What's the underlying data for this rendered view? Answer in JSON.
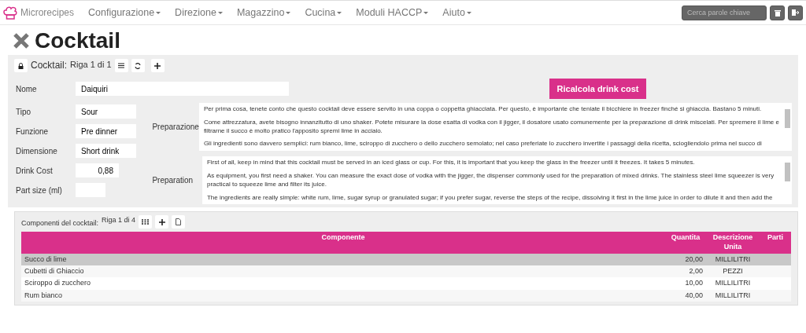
{
  "navbar": {
    "brand": "Microrecipes",
    "menus": [
      {
        "label": "Configurazione"
      },
      {
        "label": "Direzione"
      },
      {
        "label": "Magazzino"
      },
      {
        "label": "Cucina"
      },
      {
        "label": "Moduli HACCP"
      },
      {
        "label": "Aiuto"
      }
    ],
    "search": {
      "placeholder": "Cerca parole chiave"
    }
  },
  "page_title": "Cocktail",
  "record_bar": {
    "label": "Cocktail:",
    "counter": "Riga 1 di 1"
  },
  "name_field": {
    "label": "Nome",
    "value": "Daiquiri"
  },
  "recalc_button": "Ricalcola drink cost",
  "fields": [
    {
      "label": "Tipo",
      "value": "Sour",
      "kind": "text"
    },
    {
      "label": "Funzione",
      "value": "Pre dinner",
      "kind": "text"
    },
    {
      "label": "Dimensione",
      "value": "Short drink",
      "kind": "text"
    },
    {
      "label": "Drink Cost",
      "value": "0,88",
      "kind": "number"
    },
    {
      "label": "Part size (ml)",
      "kind": "number"
    }
  ],
  "texts": [
    {
      "label": "Preparazione",
      "paragraphs": [
        "Per prima cosa, tenete conto che questo cocktail deve essere servito in una coppa o coppetta ghiacciata. Per questo, è importante che teniate il bicchiere in freezer finché si ghiaccia. Bastano 5 minuti.",
        "Come attrezzatura, avete bisogno innanzitutto di uno shaker. Potete misurare la dose esatta di vodka con il jigger, il dosatore usato comunemente per la preparazione di drink miscelati. Per spremere il lime e filtrarne il succo è molto pratico l'apposito spremi lime in acciaio.",
        "Gli ingredienti sono davvero semplici: rum bianco, lime, sciroppo di zucchero o dello zucchero semolato; nel caso preferiate lo zucchero invertite i passaggi della ricetta, sciogliendolo prima nel succo di"
      ]
    },
    {
      "label": "Preparation",
      "paragraphs": [
        "First of all, keep in mind that this cocktail must be served in an iced glass or cup. For this, it is important that you keep the glass in the freezer until it freezes. It takes 5 minutes.",
        "As equipment, you first need a shaker. You can measure the exact dose of vodka with the jigger, the dispenser commonly used for the preparation of mixed drinks. The stainless steel lime squeezer is very practical to squeeze lime and filter its juice.",
        "The ingredients are really simple: white rum, lime, sugar syrup or granulated sugar; if you prefer sugar, reverse the steps of the recipe, dissolving it first in the lime juice in order to dilute it and then add the"
      ]
    }
  ],
  "components": {
    "label": "Componenti del cocktail:",
    "counter": "Riga 1 di 4",
    "columns": [
      "Componente",
      "Quantita",
      "Descrizione Unita",
      "Parti"
    ],
    "rows": [
      {
        "componente": "Succo di lime",
        "quantita": "20,00",
        "unita": "MILLILITRI",
        "selected": true
      },
      {
        "componente": "Cubetti di Ghiaccio",
        "quantita": "2,00",
        "unita": "PEZZI",
        "selected": false
      },
      {
        "componente": "Sciroppo di zucchero",
        "quantita": "10,00",
        "unita": "MILLILITRI",
        "selected": false
      },
      {
        "componente": "Rum bianco",
        "quantita": "40,00",
        "unita": "MILLILITRI",
        "selected": false
      }
    ]
  }
}
